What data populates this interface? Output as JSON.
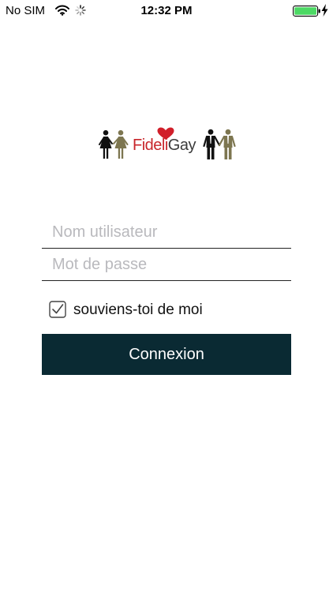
{
  "status_bar": {
    "carrier": "No SIM",
    "time": "12:32 PM",
    "battery_color": "#4cd964"
  },
  "logo": {
    "part1": "Fideli",
    "part2": "Gay",
    "part1_color": "#c8262b",
    "part2_color": "#3b3b3b",
    "heart_color": "#d11f2a"
  },
  "form": {
    "username_placeholder": "Nom utilisateur",
    "password_placeholder": "Mot de passe",
    "remember_label": "souviens-toi de moi",
    "remember_checked": true,
    "submit_label": "Connexion",
    "submit_color": "#0a2a33"
  }
}
